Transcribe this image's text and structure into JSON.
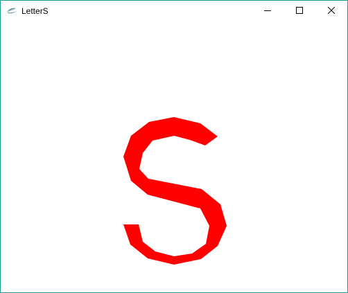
{
  "window": {
    "title": "LetterS",
    "accent_border_color": "#1b9c8c"
  },
  "titlebar": {
    "icons": {
      "app": "java-app-icon",
      "minimize": "minimize-icon",
      "maximize": "maximize-icon",
      "close": "close-icon"
    }
  },
  "canvas": {
    "shape": "letter-S-polygon",
    "fill_color": "#ff0000"
  }
}
